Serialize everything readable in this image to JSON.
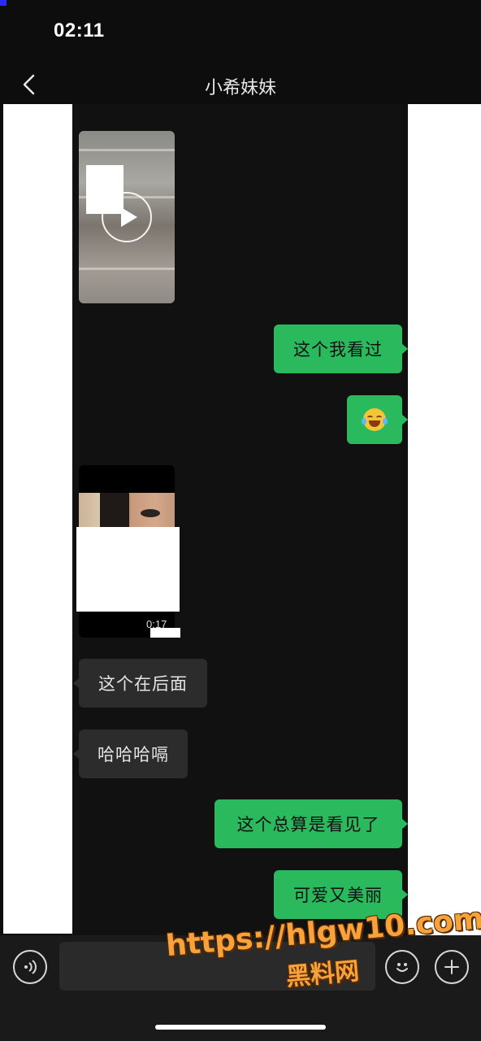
{
  "status_bar": {
    "time": "02:11"
  },
  "header": {
    "title": "小希妹妹",
    "back_icon": "chevron-left-icon"
  },
  "messages": [
    {
      "type": "video",
      "direction": "incoming",
      "icon": "play-icon"
    },
    {
      "type": "text",
      "direction": "outgoing",
      "text": "这个我看过"
    },
    {
      "type": "emoji",
      "direction": "outgoing",
      "emoji": "rolling-on-floor-laughing"
    },
    {
      "type": "video",
      "direction": "incoming",
      "duration": "0:17"
    },
    {
      "type": "text",
      "direction": "incoming",
      "text": "这个在后面"
    },
    {
      "type": "text",
      "direction": "incoming",
      "text": "哈哈哈嗝"
    },
    {
      "type": "text",
      "direction": "outgoing",
      "text": "这个总算是看见了"
    },
    {
      "type": "text",
      "direction": "outgoing",
      "text": "可爱又美丽"
    }
  ],
  "input_bar": {
    "voice_icon": "voice-icon",
    "emoji_icon": "smiley-icon",
    "plus_icon": "plus-icon"
  },
  "watermark": {
    "url": "https://hlgw10.com",
    "name": "黑料网"
  },
  "colors": {
    "outgoing_bubble": "#2bb95e",
    "incoming_bubble": "#2c2c2c",
    "background": "#111111",
    "watermark": "#f7a23a"
  }
}
